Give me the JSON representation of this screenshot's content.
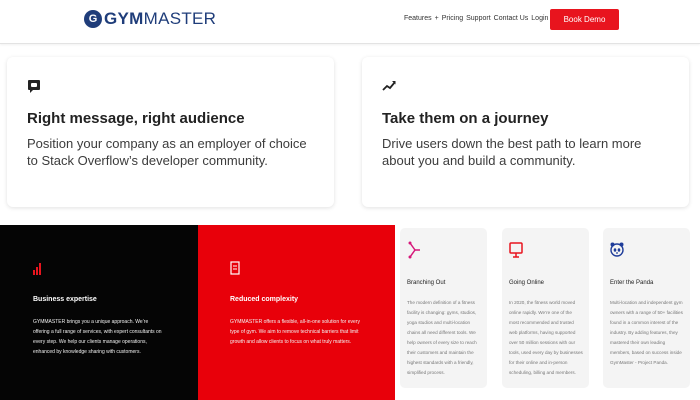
{
  "header": {
    "logo_mark": "G",
    "logo_gym": "GYM",
    "logo_master": "MASTER",
    "nav": [
      "Features",
      "Pricing",
      "Support",
      "Contact Us",
      "Login"
    ],
    "book_button": "Book Demo",
    "accent": "#e8141e"
  },
  "cards": [
    {
      "icon": "chat-icon",
      "title": "Right message, right audience",
      "desc": "Position your company as an employer of choice to Stack Overflow’s developer community."
    },
    {
      "icon": "trend-up-icon",
      "title": "Take them on a journey",
      "desc": "Drive users down the best path to learn more about you and build a community."
    }
  ],
  "panels": [
    {
      "icon": "bar-chart-icon",
      "title": "Business expertise",
      "text": "GYMMASTER brings you a unique approach. We’re offering a full range of services, with expert consultants on every step. We help our clients manage operations, enhanced by knowledge sharing with customers.",
      "bg": "#050505"
    },
    {
      "icon": "document-icon",
      "title": "Reduced complexity",
      "text": "GYMMASTER offers a flexible, all-in-one solution for every type of gym. We aim to remove technical barriers that limit growth and allow clients to focus on what truly matters.",
      "bg": "#e8000a"
    }
  ],
  "minis": [
    {
      "icon": "branch-icon",
      "title": "Branching Out",
      "text": "The modern definition of a fitness facility is changing: gyms, studios, yoga studios and multi-location chains all need different tools. We help owners of every size to reach their customers and maintain the highest standards with a friendly, simplified process."
    },
    {
      "icon": "monitor-icon",
      "title": "Going Online",
      "text": "In 2020, the fitness world moved online rapidly. We’re one of the most recommended and trusted web platforms, having supported over 50 million sessions with our tools, used every day by businesses for their online and in-person scheduling, billing and members."
    },
    {
      "icon": "panda-icon",
      "title": "Enter the Panda",
      "text": "Multi-location and independent gym owners with a range of 50+ facilities found in a common interest of the industry. By adding features, they mastered their own leading members, based on success inside GymMaster - Project Panda."
    }
  ]
}
